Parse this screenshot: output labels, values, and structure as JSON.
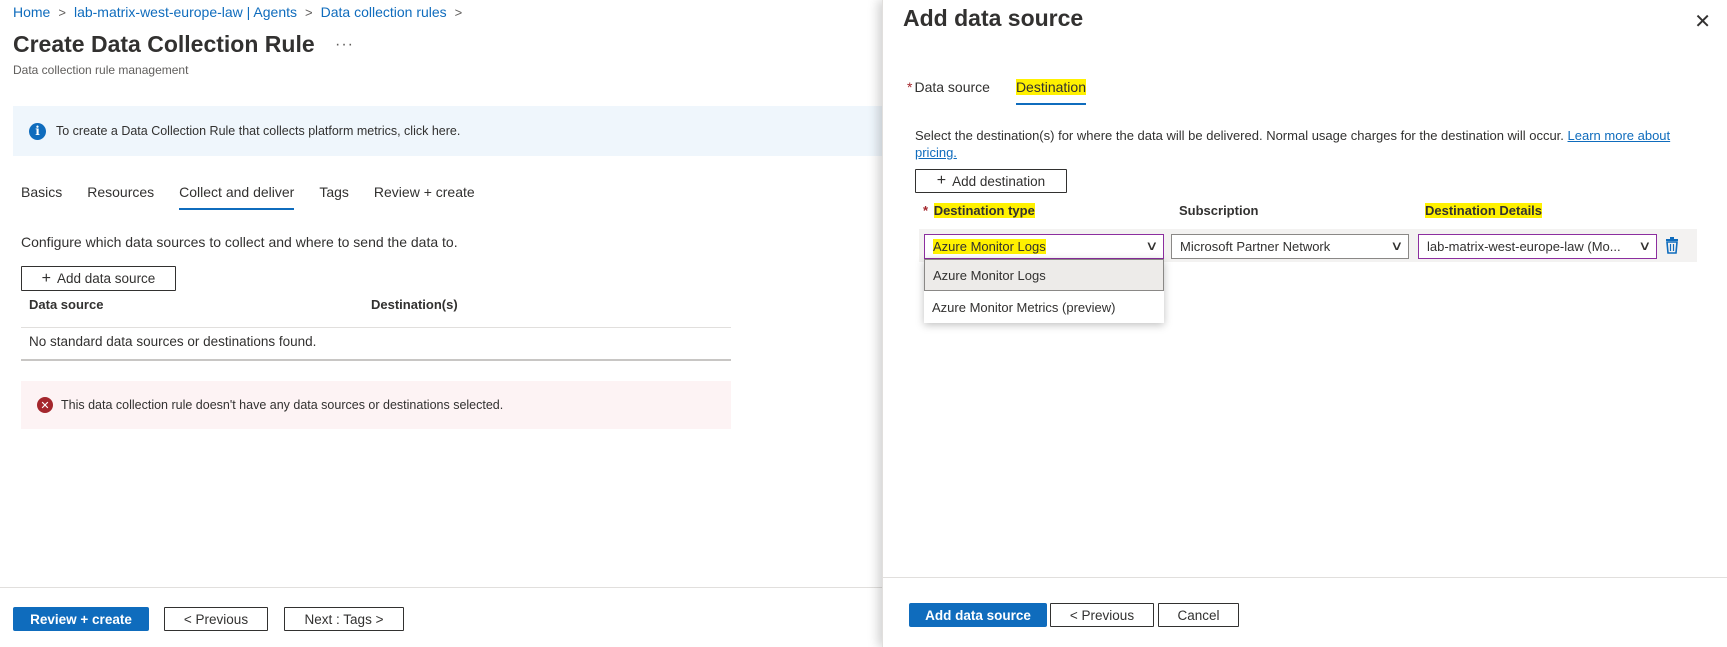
{
  "breadcrumb": [
    "Home",
    "lab-matrix-west-europe-law | Agents",
    "Data collection rules"
  ],
  "page": {
    "title": "Create Data Collection Rule",
    "more": "···",
    "subtitle": "Data collection rule management"
  },
  "info_banner": "To create a Data Collection Rule that collects platform metrics, click here.",
  "tabs": [
    "Basics",
    "Resources",
    "Collect and deliver",
    "Tags",
    "Review + create"
  ],
  "active_tab": "Collect and deliver",
  "collect": {
    "description": "Configure which data sources to collect and where to send the data to.",
    "add_button": "Add data source",
    "columns": [
      "Data source",
      "Destination(s)"
    ],
    "empty_text": "No standard data sources or destinations found.",
    "error": "This data collection rule doesn't have any data sources or destinations selected."
  },
  "footer": {
    "review": "Review + create",
    "previous": "< Previous",
    "next": "Next : Tags >"
  },
  "panel": {
    "title": "Add data source",
    "tabs": [
      "Data source",
      "Destination"
    ],
    "active_tab": "Destination",
    "description": "Select the destination(s) for where the data will be delivered. Normal usage charges for the destination will occur.",
    "learn_more": "Learn more about pricing.",
    "add_destination": "Add destination",
    "columns": {
      "type": "Destination type",
      "subscription": "Subscription",
      "details": "Destination Details"
    },
    "row": {
      "type": "Azure Monitor Logs",
      "subscription": "Microsoft Partner Network",
      "details": "lab-matrix-west-europe-law (Mo..."
    },
    "options": [
      "Azure Monitor Logs",
      "Azure Monitor Metrics (preview)"
    ],
    "selected_option": "Azure Monitor Logs",
    "footer": {
      "add": "Add data source",
      "previous": "< Previous",
      "cancel": "Cancel"
    }
  },
  "colors": {
    "accent": "#0f6cbd",
    "highlight": "#fff100",
    "error": "#a4262c",
    "focus_border": "#8c2e9f"
  },
  "icons": [
    "chevron-right-icon",
    "more-icon",
    "info-icon",
    "plus-icon",
    "error-icon",
    "close-icon",
    "chevron-down-icon",
    "trash-icon"
  ]
}
